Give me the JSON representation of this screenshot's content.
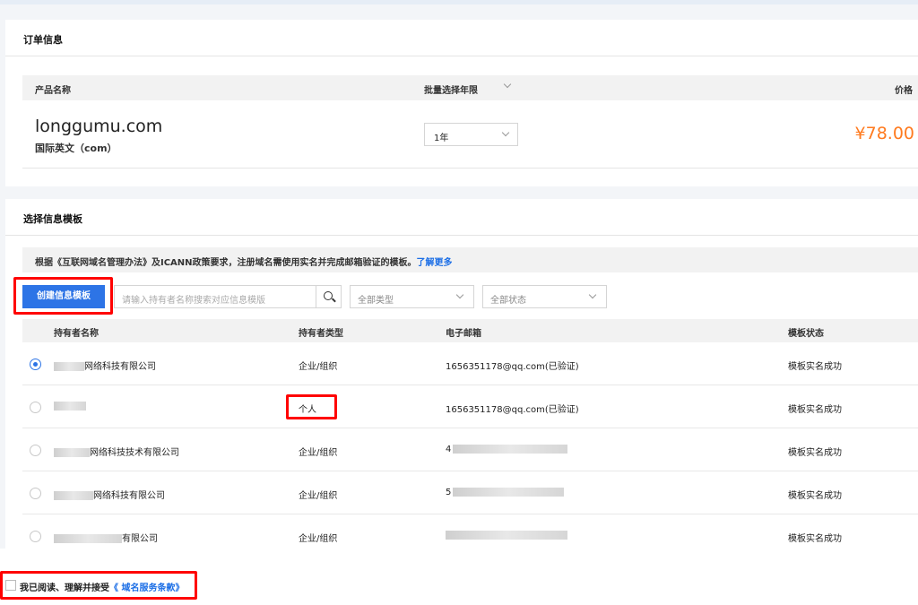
{
  "order": {
    "title": "订单信息",
    "headers": {
      "product": "产品名称",
      "years": "批量选择年限",
      "price": "价格"
    },
    "product_name": "longgumu.com",
    "product_sub": "国际英文（com）",
    "year_value": "1年",
    "price": "¥78.00"
  },
  "template": {
    "title": "选择信息模板",
    "notice_text": "根据《互联网域名管理办法》及ICANN政策要求，注册域名需使用实名并完成邮箱验证的模板。",
    "notice_link": "了解更多",
    "create_button": "创建信息模板",
    "search_placeholder": "请输入持有者名称搜索对应信息模版",
    "type_filter": "全部类型",
    "status_filter": "全部状态",
    "headers": {
      "holder": "持有者名称",
      "type": "持有者类型",
      "email": "电子邮箱",
      "status": "模板状态"
    },
    "rows": [
      {
        "holder": "网络科技有限公司",
        "type": "企业/组织",
        "email": "1656351178@qq.com(已验证)",
        "status": "模板实名成功",
        "selected": true
      },
      {
        "holder": "",
        "type": "个人",
        "email": "1656351178@qq.com(已验证)",
        "status": "模板实名成功",
        "selected": false
      },
      {
        "holder": "网络科技技术有限公司",
        "type": "企业/组织",
        "email": "4",
        "status": "模板实名成功",
        "selected": false
      },
      {
        "holder": "网络科技有限公司",
        "type": "企业/组织",
        "email": "5",
        "status": "模板实名成功",
        "selected": false
      },
      {
        "holder": "有限公司",
        "type": "企业/组织",
        "email": "",
        "status": "模板实名成功",
        "selected": false
      }
    ]
  },
  "footer": {
    "agree_text": "我已阅读、理解并接受",
    "agree_link": "《 域名服务条款》"
  },
  "colors": {
    "accent": "#2d74e6",
    "price": "#ff7a1e",
    "highlight": "#ff0000"
  }
}
